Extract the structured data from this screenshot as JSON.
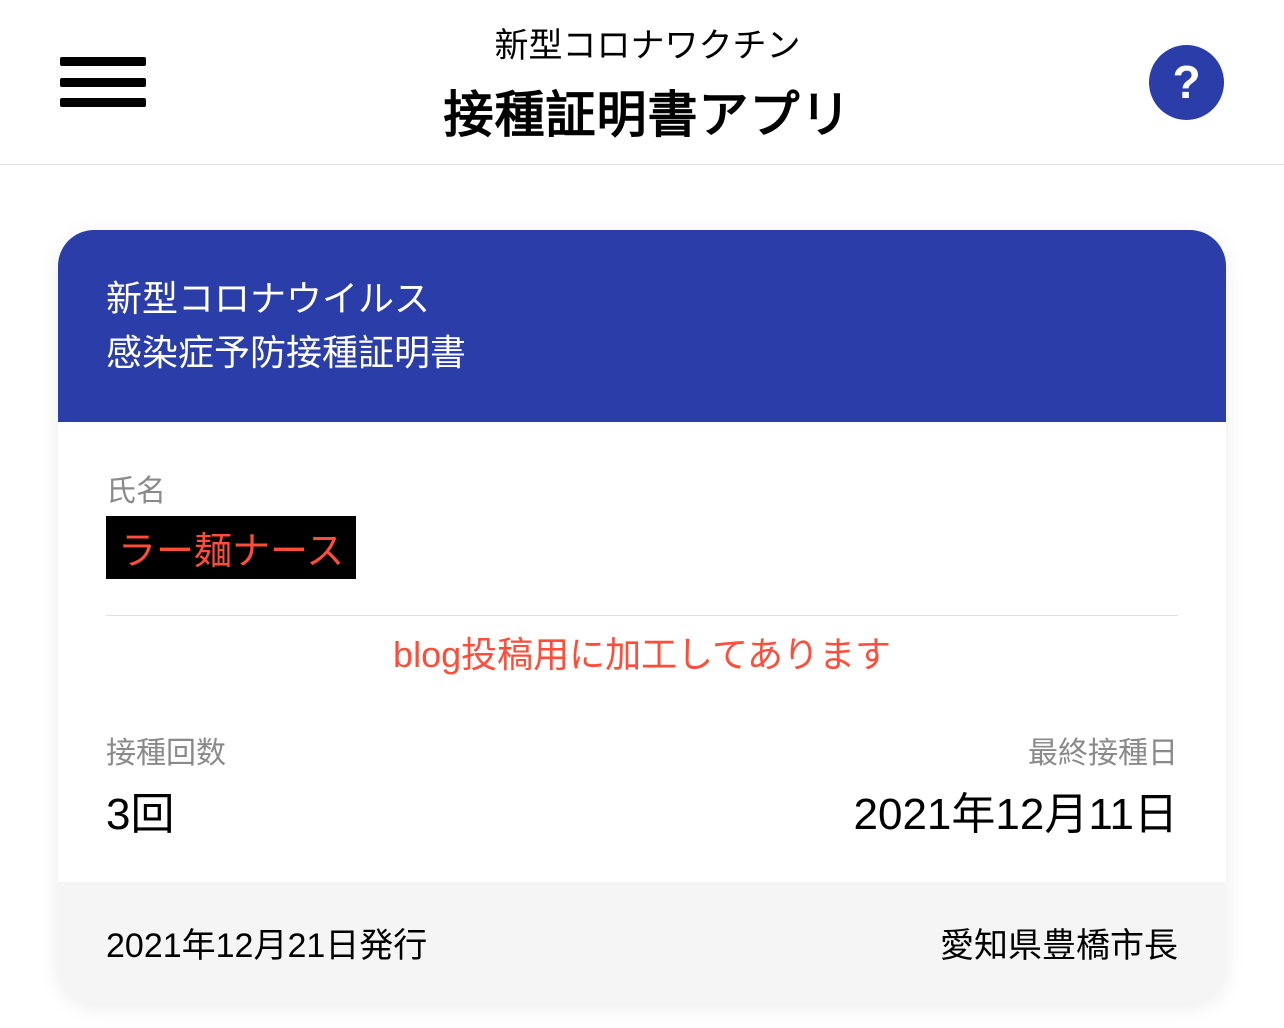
{
  "header": {
    "subtitle": "新型コロナワクチン",
    "title": "接種証明書アプリ",
    "help_label": "?"
  },
  "card": {
    "header_line1": "新型コロナウイルス",
    "header_line2": "感染症予防接種証明書",
    "name_label": "氏名",
    "name_value": "ラー麺ナース",
    "notice": "blog投稿用に加工してあります",
    "dose_count_label": "接種回数",
    "dose_count_value": "3回",
    "last_dose_label": "最終接種日",
    "last_dose_value": "2021年12月11日",
    "issue_date": "2021年12月21日発行",
    "issuer": "愛知県豊橋市長"
  }
}
